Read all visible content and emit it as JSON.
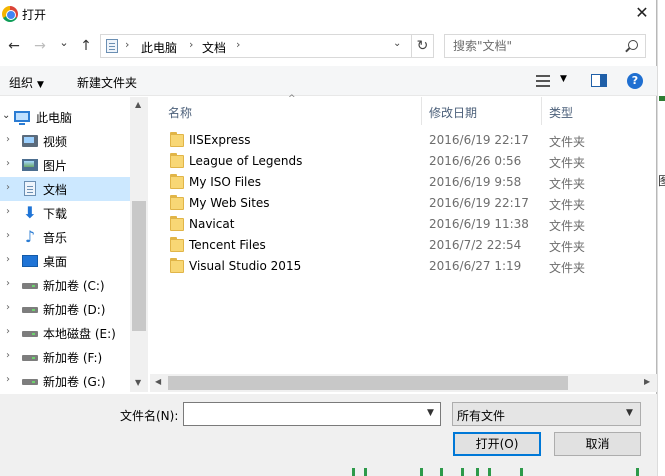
{
  "window": {
    "title": "打开",
    "close_glyph": "✕"
  },
  "nav": {
    "back_glyph": "←",
    "forward_glyph": "→",
    "dropdown_glyph": "⌄",
    "up_glyph": "↑",
    "breadcrumb": [
      "此电脑",
      "文档"
    ],
    "separator_glyph": "›",
    "refresh_glyph": "↻",
    "search_placeholder": "搜索\"文档\""
  },
  "toolbar": {
    "organize_label": "组织",
    "organize_arrow": "▼",
    "new_folder_label": "新建文件夹",
    "view_arrow": "▼",
    "help_glyph": "?"
  },
  "sidebar": {
    "items": [
      {
        "label": "此电脑",
        "icon": "computer-icon"
      },
      {
        "label": "视频",
        "icon": "video-icon"
      },
      {
        "label": "图片",
        "icon": "pictures-icon"
      },
      {
        "label": "文档",
        "icon": "documents-icon",
        "selected": true
      },
      {
        "label": "下载",
        "icon": "download-icon"
      },
      {
        "label": "音乐",
        "icon": "music-icon"
      },
      {
        "label": "桌面",
        "icon": "desktop-icon"
      },
      {
        "label": "新加卷 (C:)",
        "icon": "drive-icon"
      },
      {
        "label": "新加卷 (D:)",
        "icon": "drive-icon"
      },
      {
        "label": "本地磁盘 (E:)",
        "icon": "drive-icon"
      },
      {
        "label": "新加卷 (F:)",
        "icon": "drive-icon"
      },
      {
        "label": "新加卷 (G:)",
        "icon": "drive-icon"
      }
    ],
    "chevron_open": "⌄",
    "chevron_closed": "›",
    "download_glyph": "⬇",
    "music_glyph": "♪"
  },
  "files": {
    "columns": {
      "name": "名称",
      "modified": "修改日期",
      "type": "类型"
    },
    "sort_glyph": "^",
    "rows": [
      {
        "name": "IISExpress",
        "date": "2016/6/19 22:17",
        "type": "文件夹"
      },
      {
        "name": "League of Legends",
        "date": "2016/6/26 0:56",
        "type": "文件夹"
      },
      {
        "name": "My ISO Files",
        "date": "2016/6/19 9:58",
        "type": "文件夹"
      },
      {
        "name": "My Web Sites",
        "date": "2016/6/19 22:17",
        "type": "文件夹"
      },
      {
        "name": "Navicat",
        "date": "2016/6/19 11:38",
        "type": "文件夹"
      },
      {
        "name": "Tencent Files",
        "date": "2016/7/2 22:54",
        "type": "文件夹"
      },
      {
        "name": "Visual Studio 2015",
        "date": "2016/6/27 1:19",
        "type": "文件夹"
      }
    ]
  },
  "scroll_glyphs": {
    "up": "▲",
    "down": "▼",
    "left": "◀",
    "right": "▶"
  },
  "footer": {
    "filename_label": "文件名(N):",
    "filename_value": "",
    "filename_arrow": "▼",
    "filter_value": "所有文件",
    "filter_arrow": "▼",
    "open_label": "打开(O)",
    "cancel_label": "取消"
  },
  "background_app": {
    "edge_text": "图"
  },
  "colors": {
    "selection": "#cce8ff",
    "accent": "#0078d7",
    "folder": "#f8d775"
  }
}
